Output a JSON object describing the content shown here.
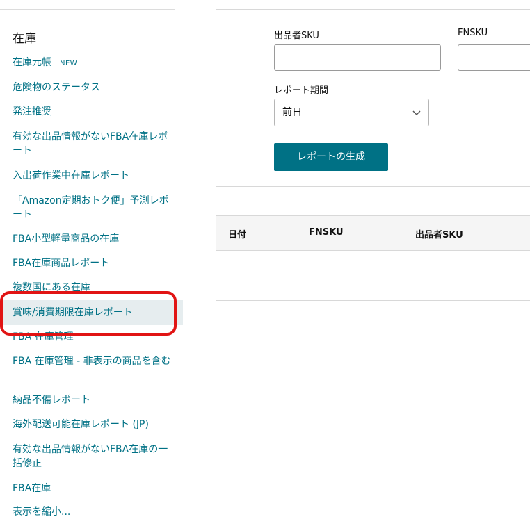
{
  "sidebar": {
    "heading": "在庫",
    "items": [
      {
        "label": "在庫元帳",
        "badge": "NEW"
      },
      {
        "label": "危険物のステータス"
      },
      {
        "label": "発注推奨"
      },
      {
        "label": "有効な出品情報がないFBA在庫レポート"
      },
      {
        "label": "入出荷作業中在庫レポート"
      },
      {
        "label": "「Amazon定期おトク便」予測レポート"
      },
      {
        "label": "FBA小型軽量商品の在庫"
      },
      {
        "label": "FBA在庫商品レポート"
      },
      {
        "label": "複数国にある在庫"
      },
      {
        "label": "賞味/消費期限在庫レポート"
      },
      {
        "label": "FBA 在庫管理"
      },
      {
        "label": "FBA 在庫管理 - 非表示の商品を含む"
      },
      {
        "label": "納品不備レポート"
      },
      {
        "label": "海外配送可能在庫レポート (JP)"
      },
      {
        "label": "有効な出品情報がないFBA在庫の一括修正"
      },
      {
        "label": "FBA在庫"
      },
      {
        "label": "表示を縮小..."
      }
    ]
  },
  "form": {
    "seller_sku_label": "出品者SKU",
    "seller_sku_value": "",
    "fnsku_label": "FNSKU",
    "fnsku_value": "",
    "period_label": "レポート期間",
    "period_value": "前日",
    "generate_button": "レポートの生成"
  },
  "table": {
    "columns": [
      "日付",
      "FNSKU",
      "出品者SKU"
    ]
  },
  "colors": {
    "link": "#007185",
    "button": "#007185",
    "highlight": "#e11414"
  }
}
